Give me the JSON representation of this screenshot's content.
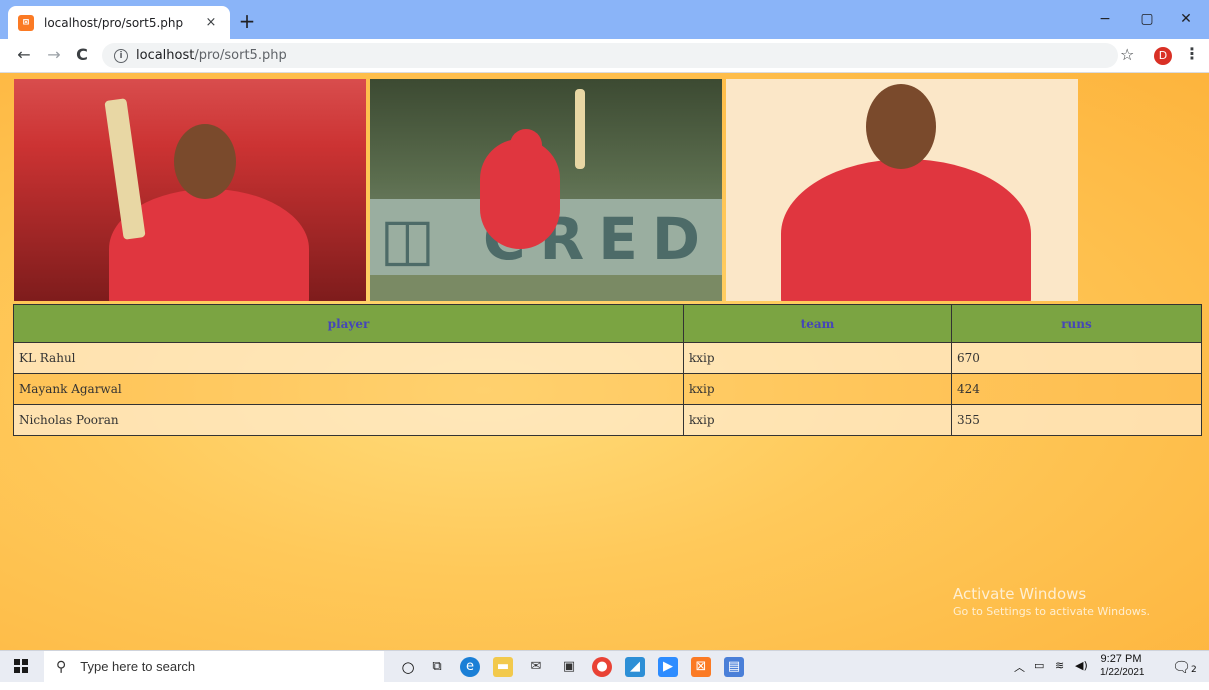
{
  "browser": {
    "tab_title": "localhost/pro/sort5.php",
    "tab_close": "×",
    "new_tab": "+",
    "url_host": "localhost",
    "url_path": "/pro/sort5.php",
    "profile_initial": "D",
    "favicon_text": "⊠",
    "window_controls": {
      "minimize": "−",
      "maximize": "▢",
      "close": "✕"
    }
  },
  "table": {
    "headers": {
      "player": "player",
      "team": "team",
      "runs": "runs"
    },
    "rows": [
      {
        "player": "KL Rahul",
        "team": "kxip",
        "runs": "670"
      },
      {
        "player": "Mayank Agarwal",
        "team": "kxip",
        "runs": "424"
      },
      {
        "player": "Nicholas Pooran",
        "team": "kxip",
        "runs": "355"
      }
    ]
  },
  "photos": {
    "p2_board_text": "◫ CRED ◫ CR"
  },
  "watermark": {
    "line1": "Activate Windows",
    "line2": "Go to Settings to activate Windows."
  },
  "taskbar": {
    "search_placeholder": "Type here to search",
    "time": "9:27 PM",
    "date": "1/22/2021",
    "notification_count": "2"
  },
  "colors": {
    "tab_bar": "#8ab4f8",
    "table_header_bg": "#7ba442",
    "table_header_text": "#4646b8",
    "page_bg": "#ffc95a"
  }
}
